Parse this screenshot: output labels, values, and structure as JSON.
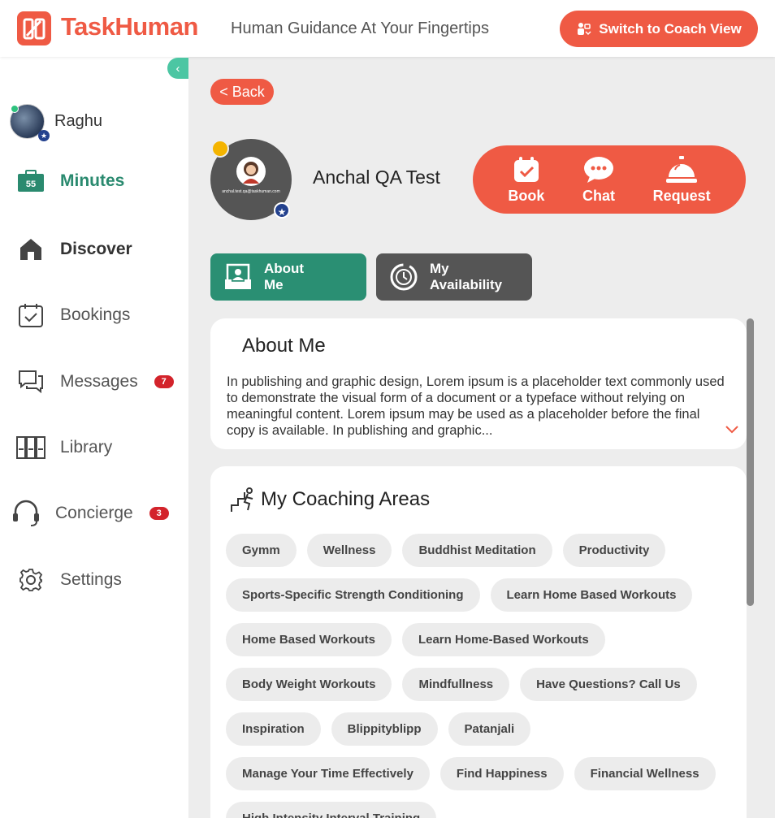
{
  "header": {
    "logo_text": "TaskHuman",
    "tagline": "Human Guidance At Your Fingertips",
    "switch_label": "Switch to Coach View"
  },
  "sidebar": {
    "user_name": "Raghu",
    "items": [
      {
        "label": "Minutes",
        "icon": "minutes-icon",
        "count_label": "55"
      },
      {
        "label": "Discover",
        "icon": "home-icon"
      },
      {
        "label": "Bookings",
        "icon": "calendar-check-icon"
      },
      {
        "label": "Messages",
        "icon": "chat-bubbles-icon",
        "badge": "7"
      },
      {
        "label": "Library",
        "icon": "library-icon"
      },
      {
        "label": "Concierge",
        "icon": "headset-icon",
        "badge": "3"
      },
      {
        "label": "Settings",
        "icon": "gear-icon"
      }
    ]
  },
  "main": {
    "back_label": "< Back",
    "coach_name": "Anchal QA Test",
    "avatar_caption": "anchal.test.qa@taskhuman.com",
    "actions": [
      "Book",
      "Chat",
      "Request"
    ],
    "tabs": [
      {
        "line1": "About",
        "line2": "Me"
      },
      {
        "line1": "My",
        "line2": "Availability"
      }
    ],
    "about": {
      "title": "About Me",
      "text": "In publishing and graphic design, Lorem ipsum is a placeholder text commonly used to demonstrate the visual form of a document or a typeface without relying on meaningful content. Lorem ipsum may be used as a placeholder before the final copy is available. In publishing and graphic..."
    },
    "coaching_areas": {
      "title": "My Coaching Areas",
      "chips": [
        "Gymm",
        "Wellness",
        "Buddhist Meditation",
        "Productivity",
        "Sports-Specific Strength Conditioning",
        "Learn Home Based Workouts",
        "Home Based Workouts",
        "Learn Home-Based Workouts",
        "Body Weight Workouts",
        "Mindfullness",
        "Have Questions? Call Us",
        "Inspiration",
        "Blippityblipp",
        "Patanjali",
        "Manage Your Time Effectively",
        "Find Happiness",
        "Financial Wellness",
        "High Intensity Interval Training"
      ]
    }
  },
  "colors": {
    "brand": "#ef5a44",
    "accent_green": "#2a8f73",
    "teal": "#4cc6a3",
    "badge_red": "#d3232b"
  }
}
